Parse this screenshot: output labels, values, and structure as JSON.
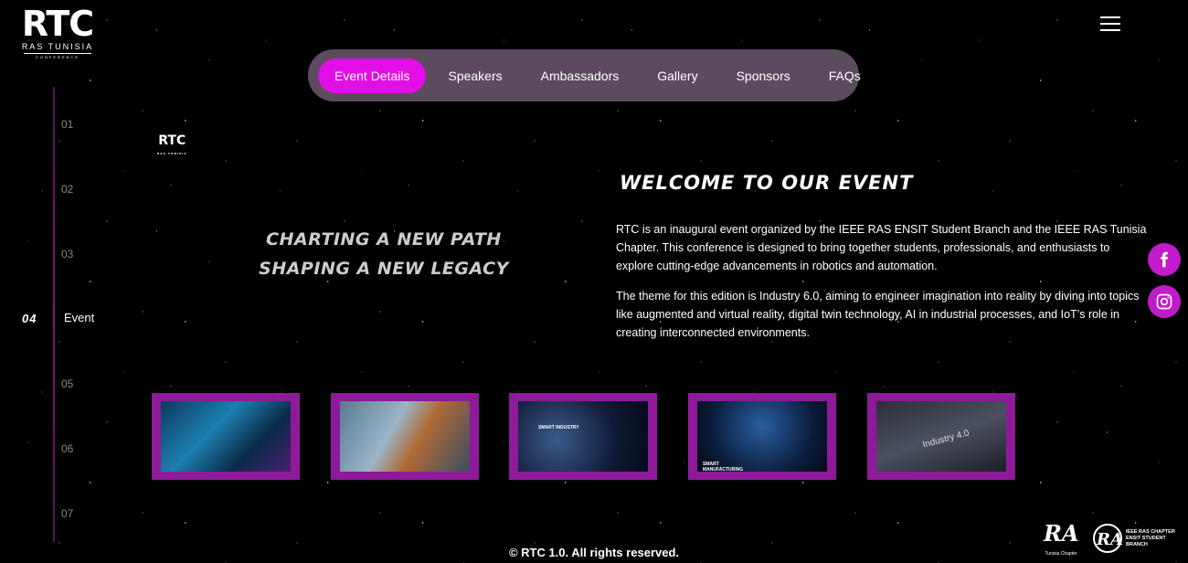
{
  "brand": {
    "logo_main": "RTC",
    "logo_sub": "RAS TUNISIA",
    "logo_sub2": "CONFERENCE"
  },
  "nav": {
    "items": [
      {
        "label": "Event Details",
        "active": true
      },
      {
        "label": "Speakers"
      },
      {
        "label": "Ambassadors"
      },
      {
        "label": "Gallery"
      },
      {
        "label": "Sponsors"
      },
      {
        "label": "FAQs"
      }
    ]
  },
  "steps": {
    "items": [
      "01",
      "02",
      "03",
      "05",
      "06",
      "07"
    ],
    "active_number": "04",
    "active_label": "Event"
  },
  "hero": {
    "small_logo": "RTC",
    "small_logo_sub": "RAS TUNISIA",
    "tagline_line1": "CHARTING A NEW PATH",
    "tagline_line2": "SHAPING A NEW LEGACY"
  },
  "about": {
    "heading": "WELCOME TO OUR EVENT",
    "para1": "RTC is an inaugural event organized by the IEEE RAS ENSIT Student Branch and the IEEE RAS Tunisia Chapter. This conference is designed to bring together students, professionals, and enthusiasts to explore cutting-edge advancements in robotics and automation.",
    "para2": "The theme for this edition is Industry 6.0, aiming to engineer imagination into reality by diving into topics like augmented and virtual reality, digital twin technology, AI in industrial processes, and IoT’s role in creating interconnected environments."
  },
  "social": {
    "facebook_icon": "facebook-icon",
    "instagram_icon": "instagram-icon",
    "accent": "#c21bcb"
  },
  "gallery": {
    "frame_color": "#8e1a9a",
    "thumbs": [
      {
        "caption": ""
      },
      {
        "caption": ""
      },
      {
        "caption": "SMART INDUSTRY"
      },
      {
        "caption": "SMART MANUFACTURING"
      },
      {
        "caption": "Industry 4.0"
      }
    ]
  },
  "footer": {
    "copyright": "© RTC 1.0. All rights reserved.",
    "partner1_label": "Tunisia Chapter",
    "partner2_label": "IEEE RAS CHAPTER ENSIT STUDENT BRANCH"
  },
  "colors": {
    "nav_bg": "#5c4a5e",
    "active_pill": "#e20ee6"
  }
}
